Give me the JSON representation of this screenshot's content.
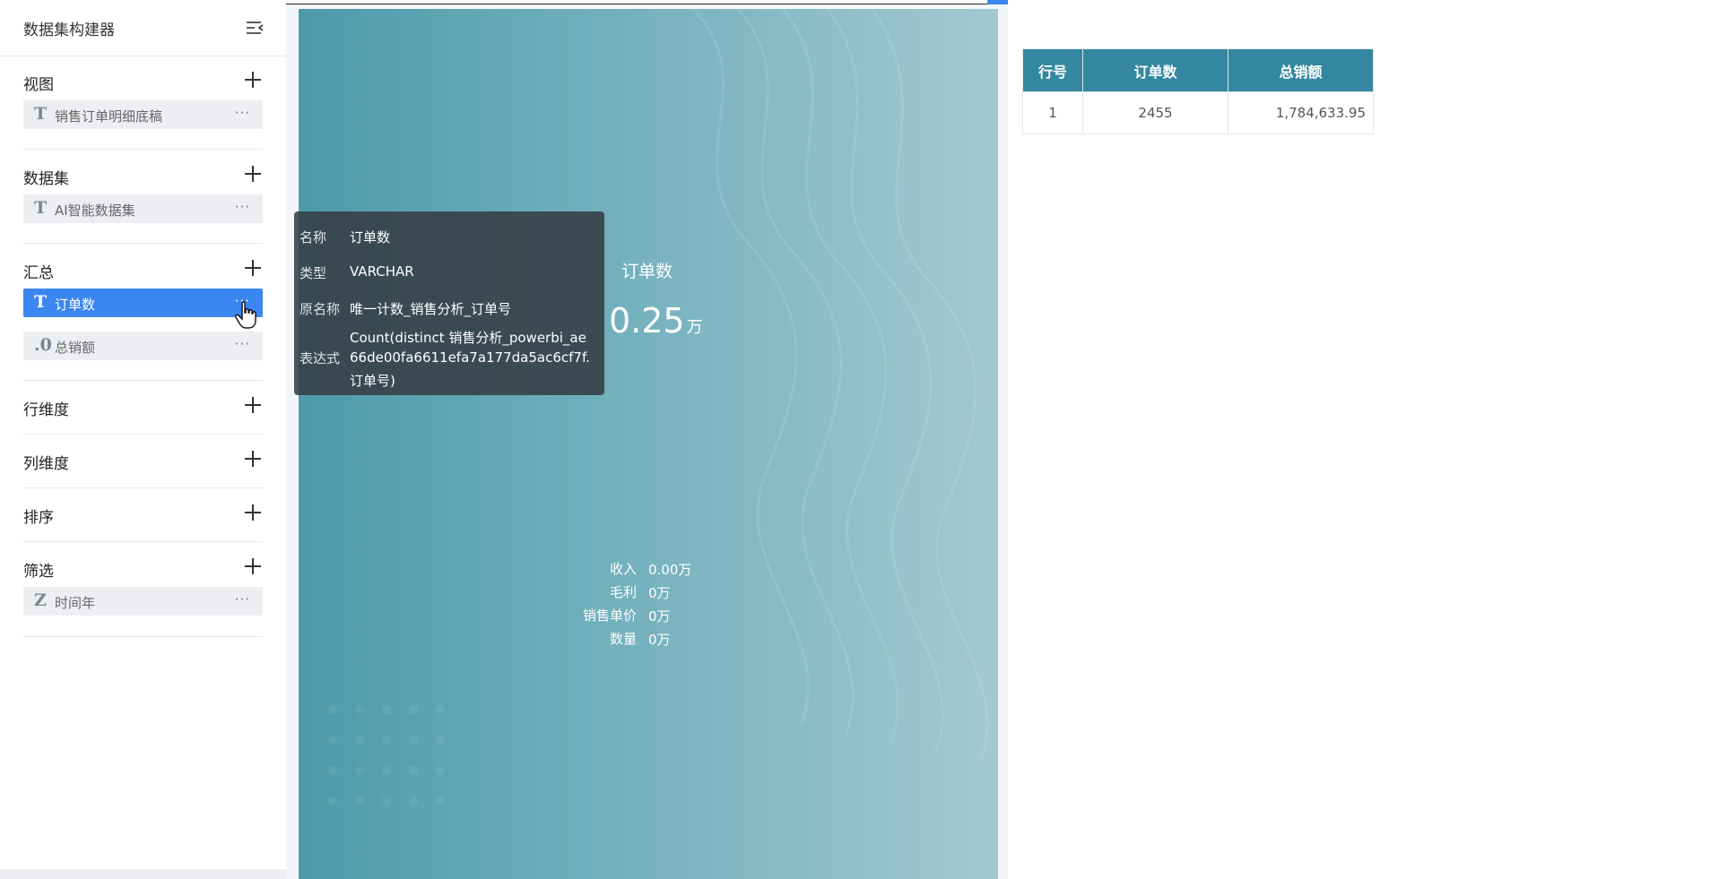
{
  "sidebar": {
    "title": "数据集构建器",
    "sections": {
      "view": {
        "title": "视图",
        "fields": [
          {
            "type_glyph": "T",
            "name": "销售订单明细底稿",
            "more": "···"
          }
        ]
      },
      "dataset": {
        "title": "数据集",
        "fields": [
          {
            "type_glyph": "T",
            "name": "AI智能数据集",
            "more": "···"
          }
        ]
      },
      "summary": {
        "title": "汇总",
        "fields": [
          {
            "type_glyph": "T",
            "name": "订单数",
            "more": "···",
            "active": true
          },
          {
            "type_glyph": ".0",
            "name": "总销额",
            "more": "···"
          }
        ]
      },
      "row_dim": {
        "title": "行维度"
      },
      "col_dim": {
        "title": "列维度"
      },
      "sort": {
        "title": "排序"
      },
      "filter": {
        "title": "筛选",
        "fields": [
          {
            "type_glyph": "Z",
            "name": "时间年",
            "more": "···"
          }
        ]
      }
    }
  },
  "tooltip": {
    "name_label": "名称",
    "name_value": "订单数",
    "type_label": "类型",
    "type_value": "VARCHAR",
    "orig_label": "原名称",
    "orig_value": "唯一计数_销售分析_订单号",
    "expr_label": "表达式",
    "expr_line1": "Count(distinct 销售分析_powerbi_ae",
    "expr_line2": "66de00fa6611efa7a177da5ac6cf7f.",
    "expr_line3": "订单号)"
  },
  "canvas": {
    "kpi_title": "订单数",
    "kpi_value": "0.25",
    "kpi_unit": "万",
    "stats": [
      {
        "label": "收入",
        "value": "0.00万"
      },
      {
        "label": "毛利",
        "value": "0万"
      },
      {
        "label": "销售单价",
        "value": "0万"
      },
      {
        "label": "数量",
        "value": "0万"
      }
    ]
  },
  "result_table": {
    "headers": [
      "行号",
      "订单数",
      "总销额"
    ],
    "rows": [
      [
        "1",
        "2455",
        "1,784,633.95"
      ]
    ]
  },
  "colors": {
    "accent": "#3b86f0",
    "table_header": "#3487a0",
    "tooltip_bg": "#343e44"
  }
}
